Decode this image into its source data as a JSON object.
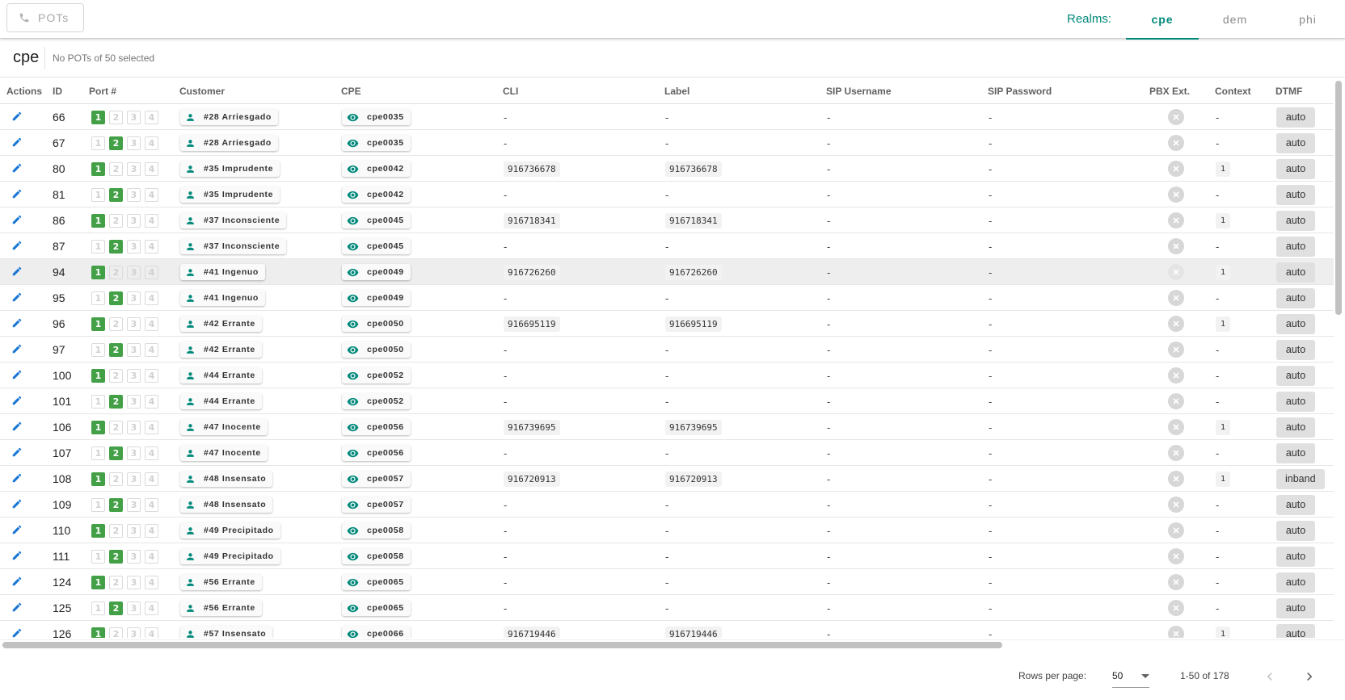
{
  "header": {
    "pots_button": "POTs",
    "realms_label": "Realms:",
    "realm_tabs": [
      {
        "label": "cpe",
        "active": true
      },
      {
        "label": "dem",
        "active": false
      },
      {
        "label": "phi",
        "active": false
      }
    ]
  },
  "subheader": {
    "realm_title": "cpe",
    "selection_status": "No POTs of 50 selected"
  },
  "colors": {
    "accent": "#00897b",
    "port_active": "#43a047",
    "edit_icon": "#1976d2"
  },
  "table": {
    "columns": [
      "Actions",
      "ID",
      "Port #",
      "Customer",
      "CPE",
      "CLI",
      "Label",
      "SIP Username",
      "SIP Password",
      "PBX Ext.",
      "Context",
      "DTMF"
    ],
    "port_numbers": [
      "1",
      "2",
      "3",
      "4"
    ],
    "rows": [
      {
        "id": "66",
        "port": 1,
        "customer": "#28 Arriesgado",
        "cpe": "cpe0035",
        "cli": "-",
        "label": "-",
        "sip_username": "-",
        "sip_password": "-",
        "context": "-",
        "dtmf": "auto"
      },
      {
        "id": "67",
        "port": 2,
        "customer": "#28 Arriesgado",
        "cpe": "cpe0035",
        "cli": "-",
        "label": "-",
        "sip_username": "-",
        "sip_password": "-",
        "context": "-",
        "dtmf": "auto"
      },
      {
        "id": "80",
        "port": 1,
        "customer": "#35 Imprudente",
        "cpe": "cpe0042",
        "cli": "916736678",
        "label": "916736678",
        "sip_username": "-",
        "sip_password": "-",
        "context": "1",
        "dtmf": "auto"
      },
      {
        "id": "81",
        "port": 2,
        "customer": "#35 Imprudente",
        "cpe": "cpe0042",
        "cli": "-",
        "label": "-",
        "sip_username": "-",
        "sip_password": "-",
        "context": "-",
        "dtmf": "auto"
      },
      {
        "id": "86",
        "port": 1,
        "customer": "#37 Inconsciente",
        "cpe": "cpe0045",
        "cli": "916718341",
        "label": "916718341",
        "sip_username": "-",
        "sip_password": "-",
        "context": "1",
        "dtmf": "auto"
      },
      {
        "id": "87",
        "port": 2,
        "customer": "#37 Inconsciente",
        "cpe": "cpe0045",
        "cli": "-",
        "label": "-",
        "sip_username": "-",
        "sip_password": "-",
        "context": "-",
        "dtmf": "auto"
      },
      {
        "id": "94",
        "port": 1,
        "customer": "#41 Ingenuo",
        "cpe": "cpe0049",
        "cli": "916726260",
        "label": "916726260",
        "sip_username": "-",
        "sip_password": "-",
        "context": "1",
        "dtmf": "auto",
        "highlighted": true
      },
      {
        "id": "95",
        "port": 2,
        "customer": "#41 Ingenuo",
        "cpe": "cpe0049",
        "cli": "-",
        "label": "-",
        "sip_username": "-",
        "sip_password": "-",
        "context": "-",
        "dtmf": "auto"
      },
      {
        "id": "96",
        "port": 1,
        "customer": "#42 Errante",
        "cpe": "cpe0050",
        "cli": "916695119",
        "label": "916695119",
        "sip_username": "-",
        "sip_password": "-",
        "context": "1",
        "dtmf": "auto"
      },
      {
        "id": "97",
        "port": 2,
        "customer": "#42 Errante",
        "cpe": "cpe0050",
        "cli": "-",
        "label": "-",
        "sip_username": "-",
        "sip_password": "-",
        "context": "-",
        "dtmf": "auto"
      },
      {
        "id": "100",
        "port": 1,
        "customer": "#44 Errante",
        "cpe": "cpe0052",
        "cli": "-",
        "label": "-",
        "sip_username": "-",
        "sip_password": "-",
        "context": "-",
        "dtmf": "auto"
      },
      {
        "id": "101",
        "port": 2,
        "customer": "#44 Errante",
        "cpe": "cpe0052",
        "cli": "-",
        "label": "-",
        "sip_username": "-",
        "sip_password": "-",
        "context": "-",
        "dtmf": "auto"
      },
      {
        "id": "106",
        "port": 1,
        "customer": "#47 Inocente",
        "cpe": "cpe0056",
        "cli": "916739695",
        "label": "916739695",
        "sip_username": "-",
        "sip_password": "-",
        "context": "1",
        "dtmf": "auto"
      },
      {
        "id": "107",
        "port": 2,
        "customer": "#47 Inocente",
        "cpe": "cpe0056",
        "cli": "-",
        "label": "-",
        "sip_username": "-",
        "sip_password": "-",
        "context": "-",
        "dtmf": "auto"
      },
      {
        "id": "108",
        "port": 1,
        "customer": "#48 Insensato",
        "cpe": "cpe0057",
        "cli": "916720913",
        "label": "916720913",
        "sip_username": "-",
        "sip_password": "-",
        "context": "1",
        "dtmf": "inband"
      },
      {
        "id": "109",
        "port": 2,
        "customer": "#48 Insensato",
        "cpe": "cpe0057",
        "cli": "-",
        "label": "-",
        "sip_username": "-",
        "sip_password": "-",
        "context": "-",
        "dtmf": "auto"
      },
      {
        "id": "110",
        "port": 1,
        "customer": "#49 Precipitado",
        "cpe": "cpe0058",
        "cli": "-",
        "label": "-",
        "sip_username": "-",
        "sip_password": "-",
        "context": "-",
        "dtmf": "auto"
      },
      {
        "id": "111",
        "port": 2,
        "customer": "#49 Precipitado",
        "cpe": "cpe0058",
        "cli": "-",
        "label": "-",
        "sip_username": "-",
        "sip_password": "-",
        "context": "-",
        "dtmf": "auto"
      },
      {
        "id": "124",
        "port": 1,
        "customer": "#56 Errante",
        "cpe": "cpe0065",
        "cli": "-",
        "label": "-",
        "sip_username": "-",
        "sip_password": "-",
        "context": "-",
        "dtmf": "auto"
      },
      {
        "id": "125",
        "port": 2,
        "customer": "#56 Errante",
        "cpe": "cpe0065",
        "cli": "-",
        "label": "-",
        "sip_username": "-",
        "sip_password": "-",
        "context": "-",
        "dtmf": "auto"
      },
      {
        "id": "126",
        "port": 1,
        "customer": "#57 Insensato",
        "cpe": "cpe0066",
        "cli": "916719446",
        "label": "916719446",
        "sip_username": "-",
        "sip_password": "-",
        "context": "1",
        "dtmf": "auto"
      }
    ]
  },
  "footer": {
    "rows_per_page_label": "Rows per page:",
    "rows_per_page_value": "50",
    "page_range": "1-50 of 178"
  }
}
